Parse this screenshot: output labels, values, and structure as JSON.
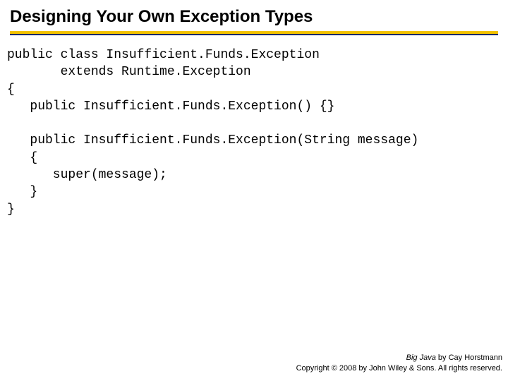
{
  "heading": "Designing Your Own Exception Types",
  "code": {
    "l01": "public class Insufficient.Funds.Exception",
    "l02": "       extends Runtime.Exception",
    "l03": "{",
    "l04": "   public Insufficient.Funds.Exception() {}",
    "l05": "",
    "l06": "   public Insufficient.Funds.Exception(String message)",
    "l07": "   {",
    "l08": "      super(message);",
    "l09": "   }",
    "l10": "}"
  },
  "footer": {
    "book_title": "Big Java",
    "byline": " by Cay Horstmann",
    "copyright": "Copyright © 2008 by John Wiley & Sons. All rights reserved."
  }
}
